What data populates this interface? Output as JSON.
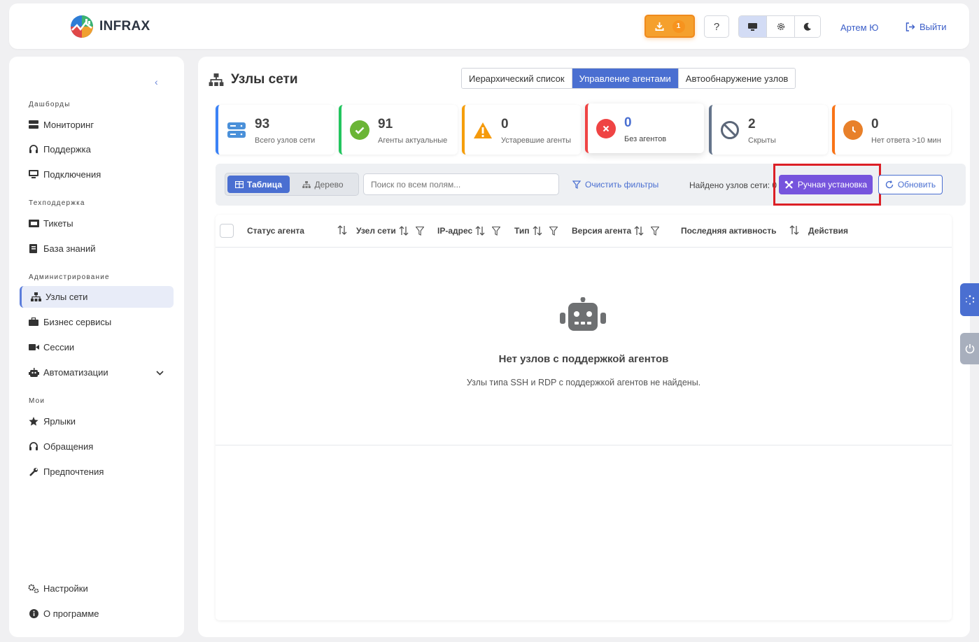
{
  "header": {
    "brand": "INFRAX",
    "download_badge": "1",
    "help_label": "?",
    "user_name": "Артем Ю",
    "logout_label": "Выйти"
  },
  "sidebar": {
    "collapse_glyph": "‹",
    "sections": [
      {
        "title": "Дашборды",
        "items": [
          "Мониторинг",
          "Поддержка",
          "Подключения"
        ]
      },
      {
        "title": "Техподдержка",
        "items": [
          "Тикеты",
          "База знаний"
        ]
      },
      {
        "title": "Администрирование",
        "items": [
          "Узлы сети",
          "Бизнес сервисы",
          "Сессии",
          "Автоматизации"
        ]
      },
      {
        "title": "Мои",
        "items": [
          "Ярлыки",
          "Обращения",
          "Предпочтения"
        ]
      }
    ],
    "active_item": "Узлы сети",
    "footer": [
      "Настройки",
      "О программе"
    ]
  },
  "page": {
    "title": "Узлы сети",
    "tabs": [
      "Иерархический список",
      "Управление агентами",
      "Автообнаружение узлов"
    ],
    "active_tab": "Управление агентами"
  },
  "stats": [
    {
      "value": "93",
      "label": "Всего узлов сети",
      "color": "#3b82f6"
    },
    {
      "value": "91",
      "label": "Агенты актуальные",
      "color": "#22c55e"
    },
    {
      "value": "0",
      "label": "Устаревшие агенты",
      "color": "#f59e0b"
    },
    {
      "value": "0",
      "label": "Без агентов",
      "color": "#ef4444"
    },
    {
      "value": "2",
      "label": "Скрыты",
      "color": "#64748b"
    },
    {
      "value": "0",
      "label": "Нет ответа >10 мин",
      "color": "#f97316"
    }
  ],
  "toolbar": {
    "view_table": "Таблица",
    "view_tree": "Дерево",
    "search_placeholder": "Поиск по всем полям...",
    "clear_filters": "Очистить фильтры",
    "found_text": "Найдено узлов сети: 0",
    "manual_install": "Ручная установка",
    "refresh": "Обновить"
  },
  "table": {
    "columns": [
      "Статус агента",
      "Узел сети",
      "IP-адрес",
      "Тип",
      "Версия агента",
      "Последняя активность",
      "Действия"
    ],
    "empty_title": "Нет узлов с поддержкой агентов",
    "empty_subtitle": "Узлы типа SSH и RDP с поддержкой агентов не найдены."
  },
  "colors": {
    "accent": "#4a6fd1",
    "manual_install": "#7654dd",
    "download": "#f5a02d",
    "highlight": "#dc1f26"
  }
}
